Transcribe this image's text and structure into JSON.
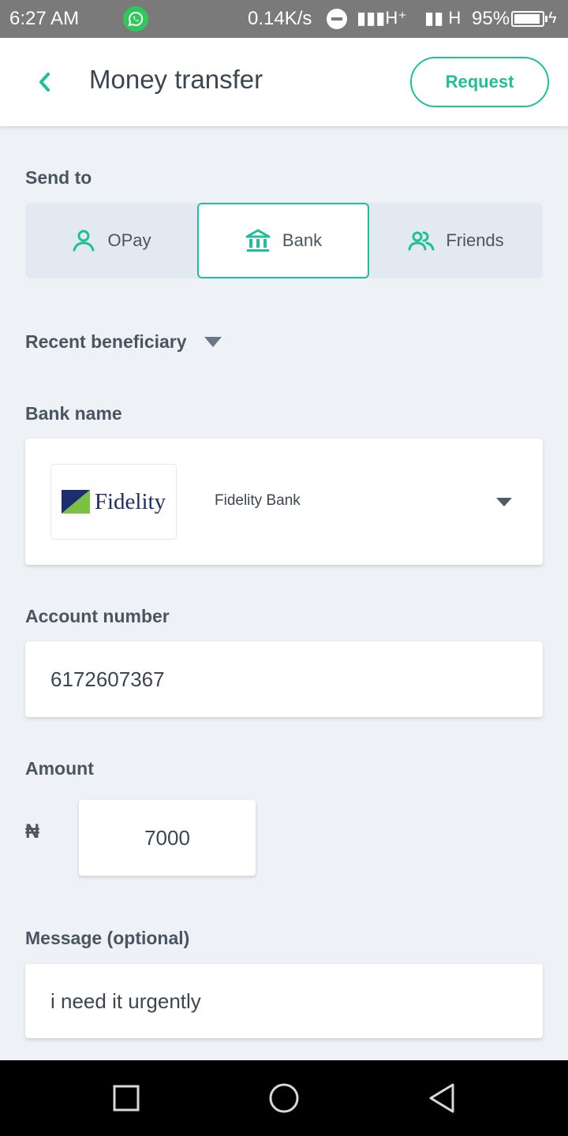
{
  "status_bar": {
    "time": "6:27 AM",
    "net_speed": "0.14K/s",
    "network_1": "H⁺",
    "network_2": "H",
    "battery": "95%",
    "battery_level": 0.95
  },
  "header": {
    "title": "Money transfer",
    "request_label": "Request"
  },
  "send_to": {
    "label": "Send to",
    "options": [
      {
        "label": "OPay",
        "icon": "person-icon",
        "selected": false
      },
      {
        "label": "Bank",
        "icon": "bank-icon",
        "selected": true
      },
      {
        "label": "Friends",
        "icon": "friends-icon",
        "selected": false
      }
    ]
  },
  "recent_beneficiary": {
    "label": "Recent beneficiary"
  },
  "bank": {
    "label": "Bank name",
    "logo_text": "Fidelity",
    "selected": "Fidelity Bank"
  },
  "account": {
    "label": "Account number",
    "value": "6172607367"
  },
  "amount": {
    "label": "Amount",
    "currency_symbol": "₦",
    "value": "7000"
  },
  "message": {
    "label": "Message (optional)",
    "value": "i need it urgently"
  },
  "colors": {
    "accent": "#1fbf99",
    "background": "#eef2f7",
    "text": "#3c4650"
  }
}
